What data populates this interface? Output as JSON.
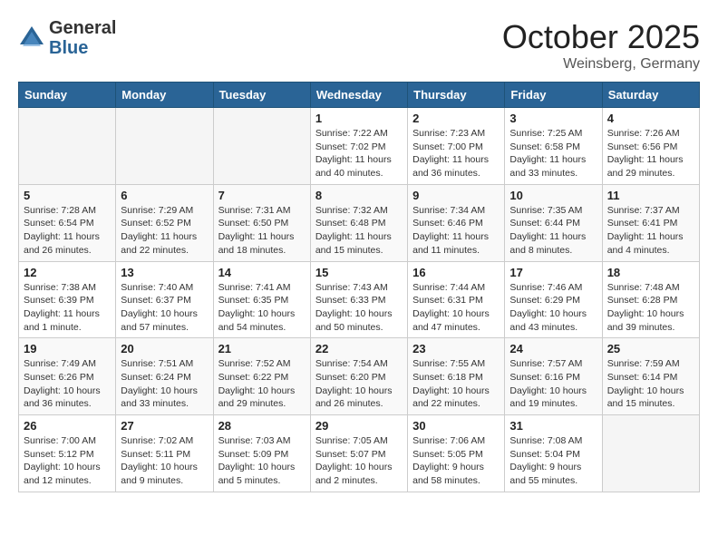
{
  "logo": {
    "general": "General",
    "blue": "Blue"
  },
  "title": "October 2025",
  "location": "Weinsberg, Germany",
  "weekdays": [
    "Sunday",
    "Monday",
    "Tuesday",
    "Wednesday",
    "Thursday",
    "Friday",
    "Saturday"
  ],
  "weeks": [
    [
      {
        "day": "",
        "info": ""
      },
      {
        "day": "",
        "info": ""
      },
      {
        "day": "",
        "info": ""
      },
      {
        "day": "1",
        "info": "Sunrise: 7:22 AM\nSunset: 7:02 PM\nDaylight: 11 hours\nand 40 minutes."
      },
      {
        "day": "2",
        "info": "Sunrise: 7:23 AM\nSunset: 7:00 PM\nDaylight: 11 hours\nand 36 minutes."
      },
      {
        "day": "3",
        "info": "Sunrise: 7:25 AM\nSunset: 6:58 PM\nDaylight: 11 hours\nand 33 minutes."
      },
      {
        "day": "4",
        "info": "Sunrise: 7:26 AM\nSunset: 6:56 PM\nDaylight: 11 hours\nand 29 minutes."
      }
    ],
    [
      {
        "day": "5",
        "info": "Sunrise: 7:28 AM\nSunset: 6:54 PM\nDaylight: 11 hours\nand 26 minutes."
      },
      {
        "day": "6",
        "info": "Sunrise: 7:29 AM\nSunset: 6:52 PM\nDaylight: 11 hours\nand 22 minutes."
      },
      {
        "day": "7",
        "info": "Sunrise: 7:31 AM\nSunset: 6:50 PM\nDaylight: 11 hours\nand 18 minutes."
      },
      {
        "day": "8",
        "info": "Sunrise: 7:32 AM\nSunset: 6:48 PM\nDaylight: 11 hours\nand 15 minutes."
      },
      {
        "day": "9",
        "info": "Sunrise: 7:34 AM\nSunset: 6:46 PM\nDaylight: 11 hours\nand 11 minutes."
      },
      {
        "day": "10",
        "info": "Sunrise: 7:35 AM\nSunset: 6:44 PM\nDaylight: 11 hours\nand 8 minutes."
      },
      {
        "day": "11",
        "info": "Sunrise: 7:37 AM\nSunset: 6:41 PM\nDaylight: 11 hours\nand 4 minutes."
      }
    ],
    [
      {
        "day": "12",
        "info": "Sunrise: 7:38 AM\nSunset: 6:39 PM\nDaylight: 11 hours\nand 1 minute."
      },
      {
        "day": "13",
        "info": "Sunrise: 7:40 AM\nSunset: 6:37 PM\nDaylight: 10 hours\nand 57 minutes."
      },
      {
        "day": "14",
        "info": "Sunrise: 7:41 AM\nSunset: 6:35 PM\nDaylight: 10 hours\nand 54 minutes."
      },
      {
        "day": "15",
        "info": "Sunrise: 7:43 AM\nSunset: 6:33 PM\nDaylight: 10 hours\nand 50 minutes."
      },
      {
        "day": "16",
        "info": "Sunrise: 7:44 AM\nSunset: 6:31 PM\nDaylight: 10 hours\nand 47 minutes."
      },
      {
        "day": "17",
        "info": "Sunrise: 7:46 AM\nSunset: 6:29 PM\nDaylight: 10 hours\nand 43 minutes."
      },
      {
        "day": "18",
        "info": "Sunrise: 7:48 AM\nSunset: 6:28 PM\nDaylight: 10 hours\nand 39 minutes."
      }
    ],
    [
      {
        "day": "19",
        "info": "Sunrise: 7:49 AM\nSunset: 6:26 PM\nDaylight: 10 hours\nand 36 minutes."
      },
      {
        "day": "20",
        "info": "Sunrise: 7:51 AM\nSunset: 6:24 PM\nDaylight: 10 hours\nand 33 minutes."
      },
      {
        "day": "21",
        "info": "Sunrise: 7:52 AM\nSunset: 6:22 PM\nDaylight: 10 hours\nand 29 minutes."
      },
      {
        "day": "22",
        "info": "Sunrise: 7:54 AM\nSunset: 6:20 PM\nDaylight: 10 hours\nand 26 minutes."
      },
      {
        "day": "23",
        "info": "Sunrise: 7:55 AM\nSunset: 6:18 PM\nDaylight: 10 hours\nand 22 minutes."
      },
      {
        "day": "24",
        "info": "Sunrise: 7:57 AM\nSunset: 6:16 PM\nDaylight: 10 hours\nand 19 minutes."
      },
      {
        "day": "25",
        "info": "Sunrise: 7:59 AM\nSunset: 6:14 PM\nDaylight: 10 hours\nand 15 minutes."
      }
    ],
    [
      {
        "day": "26",
        "info": "Sunrise: 7:00 AM\nSunset: 5:12 PM\nDaylight: 10 hours\nand 12 minutes."
      },
      {
        "day": "27",
        "info": "Sunrise: 7:02 AM\nSunset: 5:11 PM\nDaylight: 10 hours\nand 9 minutes."
      },
      {
        "day": "28",
        "info": "Sunrise: 7:03 AM\nSunset: 5:09 PM\nDaylight: 10 hours\nand 5 minutes."
      },
      {
        "day": "29",
        "info": "Sunrise: 7:05 AM\nSunset: 5:07 PM\nDaylight: 10 hours\nand 2 minutes."
      },
      {
        "day": "30",
        "info": "Sunrise: 7:06 AM\nSunset: 5:05 PM\nDaylight: 9 hours\nand 58 minutes."
      },
      {
        "day": "31",
        "info": "Sunrise: 7:08 AM\nSunset: 5:04 PM\nDaylight: 9 hours\nand 55 minutes."
      },
      {
        "day": "",
        "info": ""
      }
    ]
  ]
}
